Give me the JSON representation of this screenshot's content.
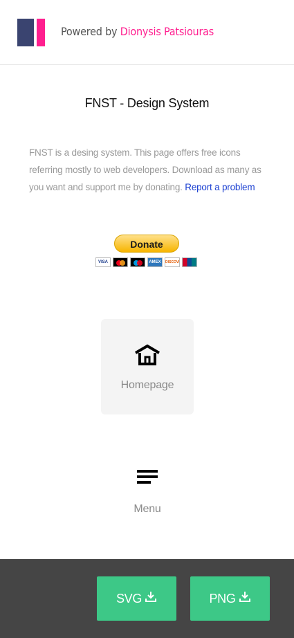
{
  "header": {
    "powered_prefix": "Powered by",
    "author": "Dionysis Patsiouras",
    "logo_colors": [
      "#3a4470",
      "#ff1f8f"
    ]
  },
  "main": {
    "title": "FNST - Design System",
    "description": "FNST is a desing system. This page offers free icons referring mostly to web developers. Download as many as you want and support me by donating.",
    "report_link": "Report a problem"
  },
  "donate": {
    "button_label": "Donate",
    "cards": [
      "VISA",
      "mastercard-icon",
      "maestro-icon",
      "AMEX",
      "DISCOVER",
      "unionpay-icon"
    ]
  },
  "icons": [
    {
      "name": "home-icon",
      "label": "Homepage",
      "selected": true
    },
    {
      "name": "menu-icon",
      "label": "Menu",
      "selected": false
    }
  ],
  "footer": {
    "svg_label": "SVG",
    "png_label": "PNG",
    "accent": "#3dc887",
    "background": "#454545"
  }
}
